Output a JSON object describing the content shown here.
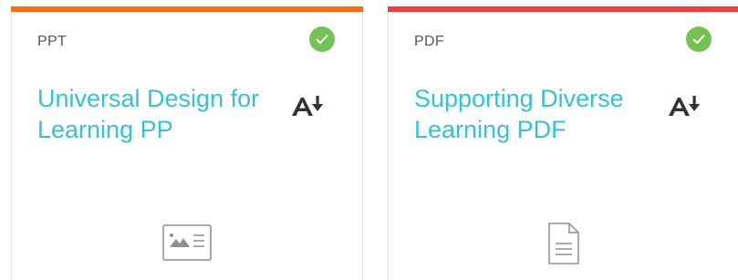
{
  "cards": [
    {
      "type_label": "PPT",
      "title": "Universal Design for Learning PP",
      "accent_color": "#F5700F",
      "title_color": "#35C2D4",
      "status": "completed",
      "status_icon": "check-circle-icon",
      "status_color": "#75C254",
      "action_icon": "download-text-icon",
      "file_icon": "presentation-file-icon"
    },
    {
      "type_label": "PDF",
      "title": "Supporting Diverse Learning PDF",
      "accent_color": "#E8413C",
      "title_color": "#35C2D4",
      "status": "completed",
      "status_icon": "check-circle-icon",
      "status_color": "#75C254",
      "action_icon": "download-text-icon",
      "file_icon": "document-file-icon"
    }
  ]
}
